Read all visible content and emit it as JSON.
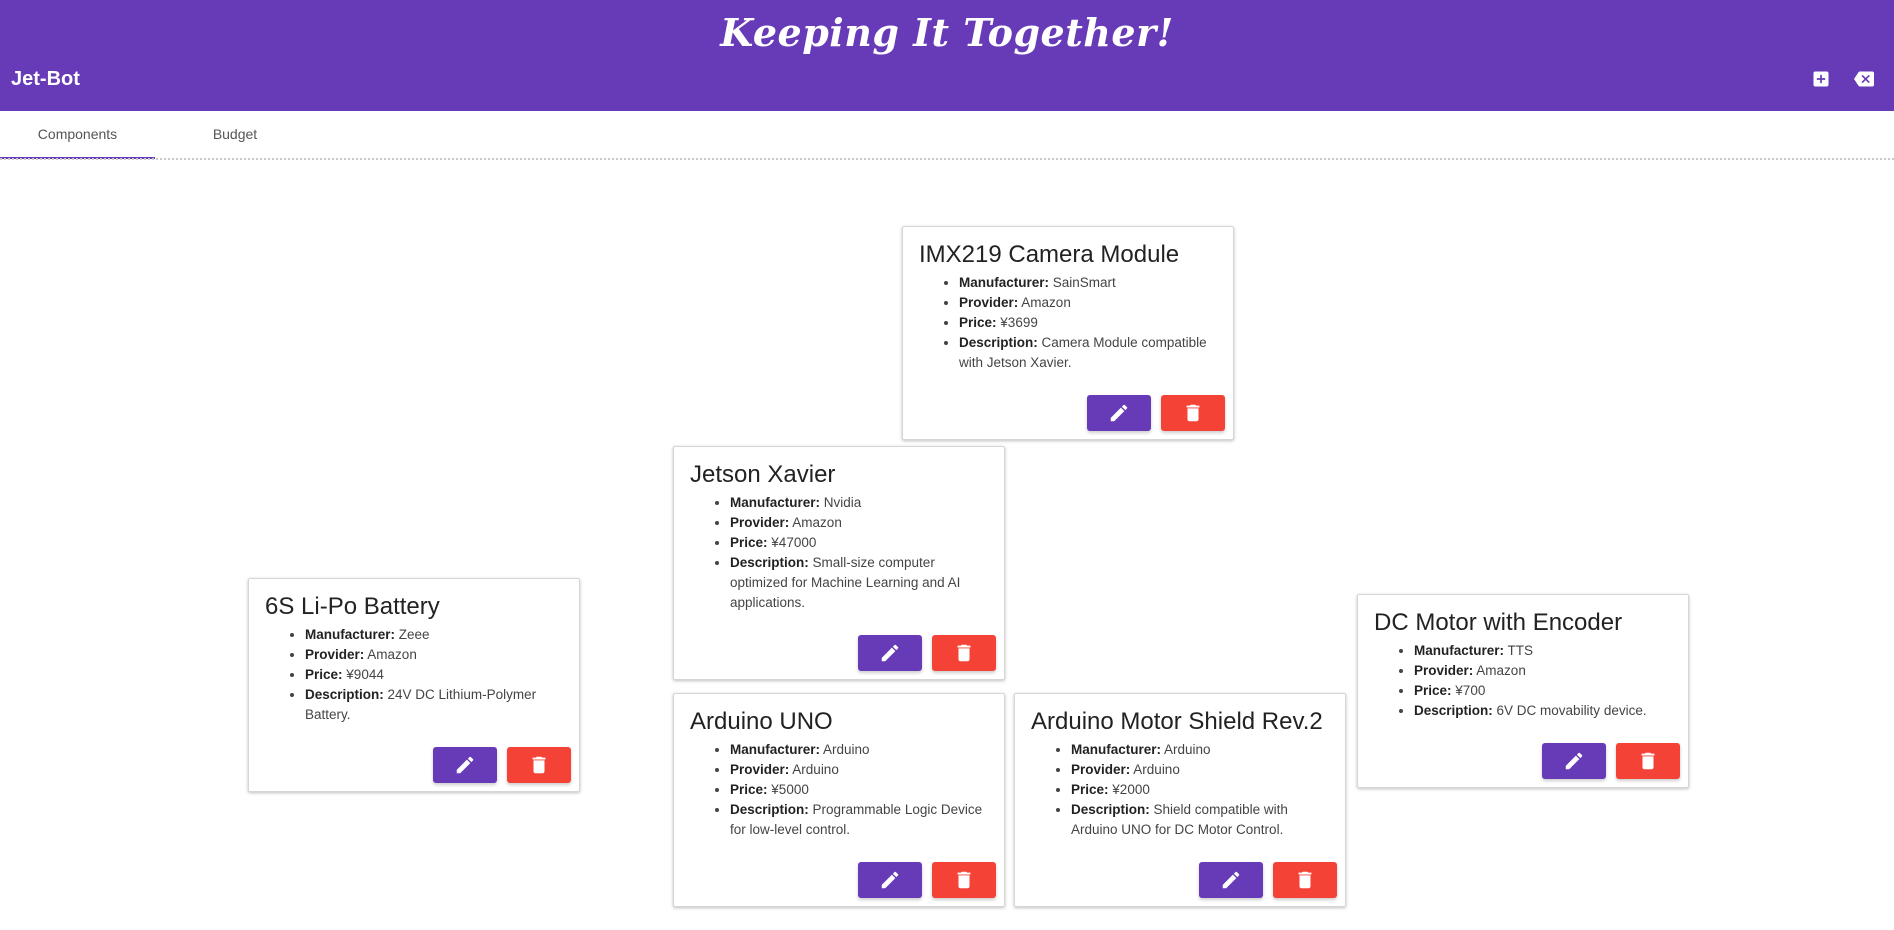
{
  "header": {
    "app_title": "Keeping It Together!",
    "project_name": "Jet-Bot",
    "icons": [
      "add-box-icon",
      "backspace-icon"
    ]
  },
  "tabs": [
    {
      "label": "Components",
      "active": true
    },
    {
      "label": "Budget",
      "active": false
    }
  ],
  "labels": {
    "manufacturer": "Manufacturer:",
    "provider": "Provider:",
    "price": "Price:",
    "description": "Description:"
  },
  "colors": {
    "primary": "#673ab7",
    "danger": "#f44336"
  },
  "components": [
    {
      "name": "IMX219 Camera Module",
      "manufacturer": "SainSmart",
      "provider": "Amazon",
      "price": "¥3699",
      "description": "Camera Module compatible with Jetson Xavier."
    },
    {
      "name": "Jetson Xavier",
      "manufacturer": "Nvidia",
      "provider": "Amazon",
      "price": "¥47000",
      "description": "Small-size computer optimized for Machine Learning and AI applications."
    },
    {
      "name": "6S Li-Po Battery",
      "manufacturer": "Zeee",
      "provider": "Amazon",
      "price": "¥9044",
      "description": "24V DC Lithium-Polymer Battery."
    },
    {
      "name": "DC Motor with Encoder",
      "manufacturer": "TTS",
      "provider": "Amazon",
      "price": "¥700",
      "description": "6V DC movability device."
    },
    {
      "name": "Arduino UNO",
      "manufacturer": "Arduino",
      "provider": "Arduino",
      "price": "¥5000",
      "description": "Programmable Logic Device for low-level control."
    },
    {
      "name": "Arduino Motor Shield Rev.2",
      "manufacturer": "Arduino",
      "provider": "Arduino",
      "price": "¥2000",
      "description": "Shield compatible with Arduino UNO for DC Motor Control."
    }
  ]
}
